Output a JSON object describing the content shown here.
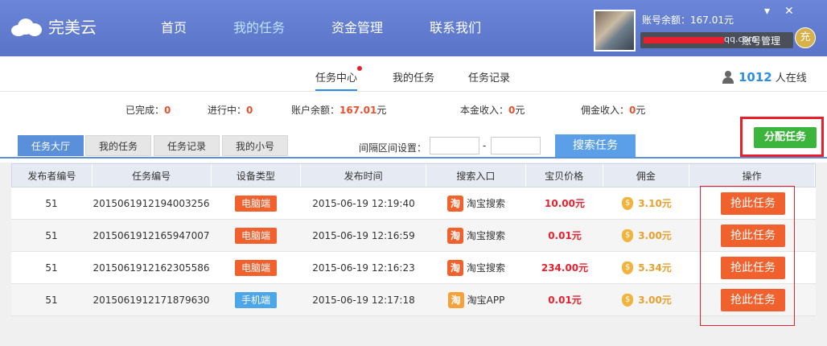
{
  "header": {
    "logo_text": "完美云",
    "nav": [
      "首页",
      "我的任务",
      "资金管理",
      "联系我们"
    ],
    "nav_active": 1,
    "balance_label": "账号余额：167.01元",
    "account_email": "qq.com",
    "account_manage": "账号管理",
    "charge": "充"
  },
  "subnav": {
    "tabs": [
      "任务中心",
      "我的任务",
      "任务记录"
    ],
    "online_count": "1012",
    "online_label": "人在线"
  },
  "stats": {
    "completed_label": "已完成：",
    "completed": "0",
    "in_progress_label": "进行中：",
    "in_progress": "0",
    "balance_label": "账户余额：",
    "balance": "167.01",
    "balance_unit": "元",
    "principal_label": "本金收入：",
    "principal": "0",
    "principal_unit": "元",
    "commission_label": "佣金收入：",
    "commission": "0",
    "commission_unit": "元"
  },
  "filters": {
    "tabs": [
      "任务大厅",
      "我的任务",
      "任务记录",
      "我的小号"
    ],
    "interval_label": "间隔区间设置：",
    "dash": "-",
    "search_button": "搜索任务",
    "assign_button": "分配任务"
  },
  "table": {
    "headers": [
      "发布者编号",
      "任务编号",
      "设备类型",
      "发布时间",
      "搜索入口",
      "宝贝价格",
      "佣金",
      "操作"
    ],
    "rows": [
      {
        "publisher": "51",
        "task_id": "2015061912194003256",
        "device": "电脑端",
        "device_type": "pc",
        "time": "2015-06-19 12:19:40",
        "entry_icon": "淘",
        "entry": "淘宝搜索",
        "price": "10.00元",
        "commission": "3.10元",
        "action": "抢此任务"
      },
      {
        "publisher": "51",
        "task_id": "2015061912165947007",
        "device": "电脑端",
        "device_type": "pc",
        "time": "2015-06-19 12:16:59",
        "entry_icon": "淘",
        "entry": "淘宝搜索",
        "price": "0.01元",
        "commission": "3.00元",
        "action": "抢此任务"
      },
      {
        "publisher": "51",
        "task_id": "2015061912162305586",
        "device": "电脑端",
        "device_type": "pc",
        "time": "2015-06-19 12:16:23",
        "entry_icon": "淘",
        "entry": "淘宝搜索",
        "price": "234.00元",
        "commission": "5.34元",
        "action": "抢此任务"
      },
      {
        "publisher": "51",
        "task_id": "2015061912171879630",
        "device": "手机端",
        "device_type": "mobile",
        "time": "2015-06-19 12:17:18",
        "entry_icon": "淘",
        "entry": "淘宝APP",
        "price": "0.01元",
        "commission": "3.00元",
        "action": "抢此任务"
      }
    ]
  }
}
